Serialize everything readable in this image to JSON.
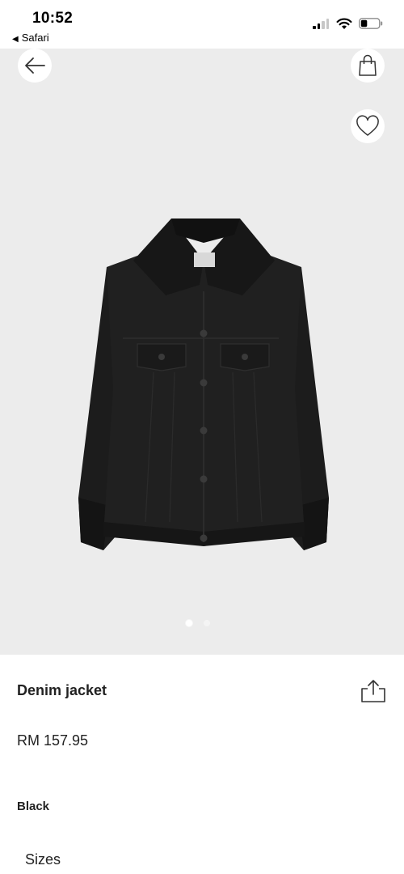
{
  "status_bar": {
    "time": "10:52",
    "back_app_label": "Safari",
    "back_app_icon": "back-triangle-icon",
    "signal_icon": "cellular-signal-icon",
    "wifi_icon": "wifi-icon",
    "battery_icon": "battery-icon",
    "battery_level": 0.3
  },
  "gallery": {
    "image_name": "black-denim-jacket-image",
    "background_color": "#ececec",
    "page_count": 2,
    "current_page": 1,
    "back_icon": "arrow-left-icon",
    "bag_icon": "shopping-bag-icon",
    "favorite_icon": "heart-outline-icon"
  },
  "product": {
    "name": "Denim jacket",
    "price": "RM 157.95",
    "color": "Black",
    "share_icon": "share-icon"
  },
  "sections": {
    "sizes_label": "Sizes"
  }
}
